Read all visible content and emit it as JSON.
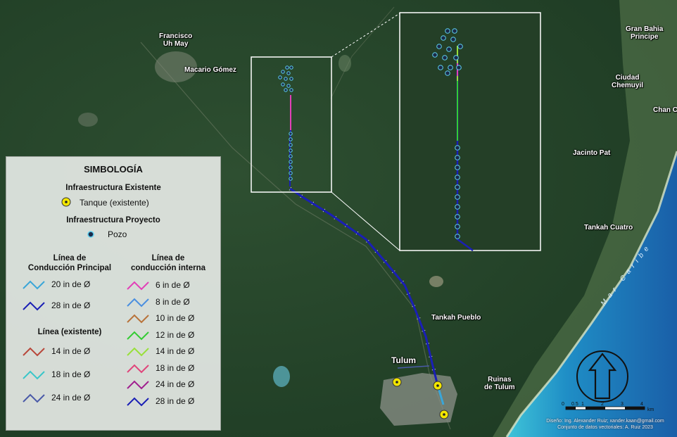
{
  "places": {
    "francisco": "Francisco\nUh May",
    "macario": "Macario Gómez",
    "gran_bahia": "Gran Bahia\nPrincipe",
    "ciudad_chemuyil": "Ciudad\nChemuyil",
    "chan": "Chan C",
    "jacinto": "Jacinto Pat",
    "tankah_cuatro": "Tankah Cuatro",
    "tankah_pueblo": "Tankah Pueblo",
    "tulum": "Tulum",
    "ruinas": "Ruinas\nde Tulum",
    "mar": "Mar Caribe"
  },
  "legend": {
    "title": "SIMBOLOGÍA",
    "existing_header": "Infraestructura Existente",
    "tank_label": "Tanque (existente)",
    "project_header": "Infraestructura Proyecto",
    "well_label": "Pozo",
    "main_line_header": "Línea de\nConducción Principal",
    "internal_line_header": "Línea de\nconducción interna",
    "existing_line_header": "Línea (existente)",
    "main_lines": [
      {
        "label": "20 in de Ø",
        "color": "#3aa6d8"
      },
      {
        "label": "28 in de Ø",
        "color": "#1a1fb5"
      }
    ],
    "existing_lines": [
      {
        "label": "14 in de Ø",
        "color": "#b8473a"
      },
      {
        "label": "18 in de Ø",
        "color": "#39c6c9"
      },
      {
        "label": "24 in de Ø",
        "color": "#4a5aa8"
      }
    ],
    "internal_lines": [
      {
        "label": "6 in de Ø",
        "color": "#e23fb8"
      },
      {
        "label": "8 in de Ø",
        "color": "#4a8fe0"
      },
      {
        "label": "10 in de Ø",
        "color": "#b8733a"
      },
      {
        "label": "12 in de Ø",
        "color": "#33cc33"
      },
      {
        "label": "14 in de Ø",
        "color": "#99e03a"
      },
      {
        "label": "18 in de Ø",
        "color": "#e0457a"
      },
      {
        "label": "24 in de Ø",
        "color": "#a01f8f"
      },
      {
        "label": "28 in de Ø",
        "color": "#1a1fb5"
      }
    ]
  },
  "scale": {
    "ticks": [
      "0",
      "0.5",
      "1",
      "2",
      "3",
      "4"
    ],
    "unit": "km"
  },
  "credits": {
    "line1": "Diseño: Ing. Alexander Ruiz; xander.kaan@gmail.com",
    "line2": "Conjunto de datos vectoriales: A. Ruiz 2023"
  },
  "colors": {
    "forest": "#24432a",
    "sea": "#1e8fc8",
    "main_line": "#1a1fb5",
    "pink_line": "#e23fb8",
    "tank": "#f2e600"
  }
}
